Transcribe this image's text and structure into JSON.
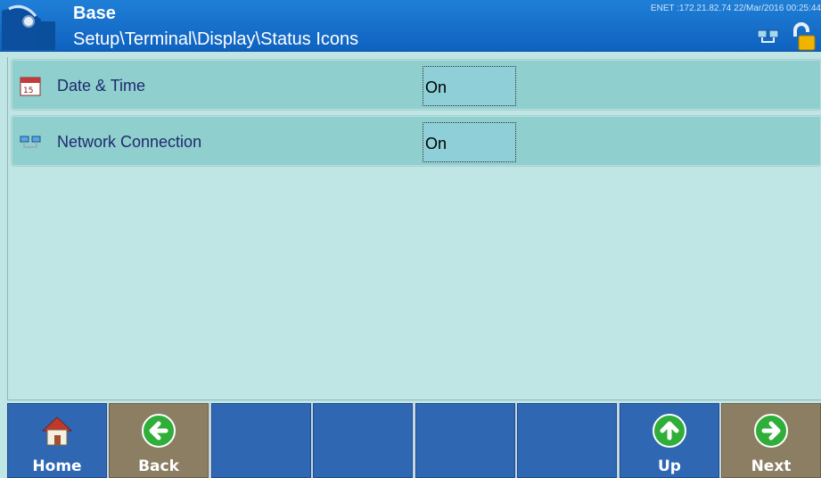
{
  "header": {
    "title": "Base",
    "path": "Setup\\Terminal\\Display\\Status Icons",
    "status_line": "ENET :172.21.82.74  22/Mar/2016 00:25:44"
  },
  "rows": [
    {
      "label": "Date & Time",
      "value": "On",
      "icon": "calendar-icon"
    },
    {
      "label": "Network Connection",
      "value": "On",
      "icon": "network-icon"
    }
  ],
  "softkeys": {
    "home": "Home",
    "back": "Back",
    "up": "Up",
    "next": "Next"
  },
  "colors": {
    "header": "#1670cc",
    "row": "#8fcfce",
    "background": "#bfe5e4",
    "key_blue": "#2f67b3",
    "key_tan": "#8c7e63"
  }
}
